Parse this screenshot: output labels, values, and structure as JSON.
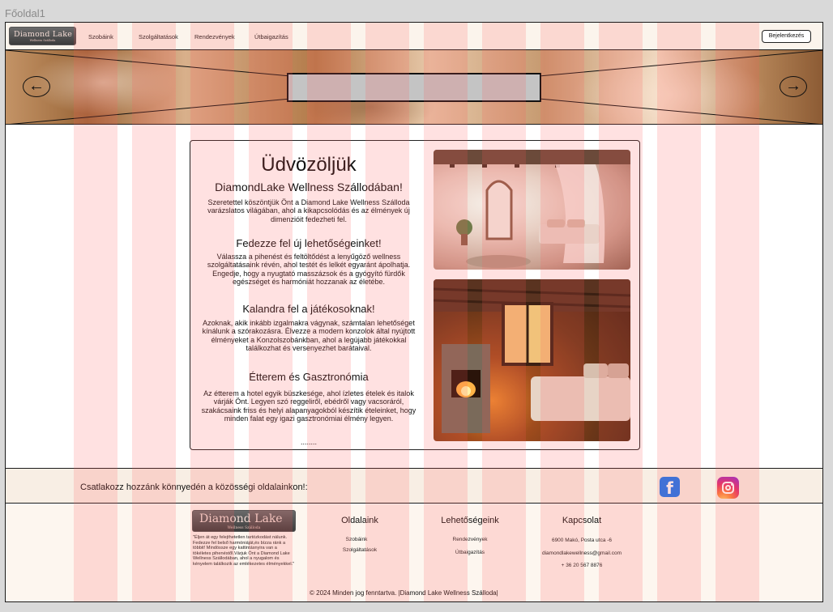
{
  "frame_label": "Főoldal1",
  "nav": {
    "logo_text": "Diamond Lake",
    "logo_sub": "Wellness Szálloda",
    "links": [
      "Szobáink",
      "Szolgáltatások",
      "Rendezvények",
      "Útbaigazítás"
    ],
    "login": "Bejelentkezés"
  },
  "hero": {
    "prev_icon": "arrow-left-icon",
    "next_icon": "arrow-right-icon"
  },
  "content": {
    "title": "Üdvözöljük",
    "subtitle": "DiamondLake Wellness Szállodában!",
    "intro": "Szeretettel köszöntjük Önt a Diamond Lake Wellness Szálloda varázslatos világában, ahol a kikapcsolódás és az élmények új dimenzióit fedezheti fel.",
    "sections": [
      {
        "heading": "Fedezze fel új lehetőségeinket!",
        "text": "Válassza a pihenést és feltöltődést a lenyűgöző wellness szolgáltatásaink révén, ahol testét és lelkét egyaránt ápolhatja. Engedje, hogy a nyugtató masszázsok és a gyógyító fürdők egészséget és harmóniát hozzanak az életébe."
      },
      {
        "heading": "Kalandra fel a játékosoknak!",
        "text": "Azoknak, akik inkább izgalmakra vágynak, számtalan lehetőséget kínálunk a szórakozásra. Élvezze a modern konzolok által nyújtott élményeket a Konzolszobánkban, ahol a legújabb játékokkal találkozhat és versenyezhet barátaival."
      },
      {
        "heading": "Étterem és Gasztronómia",
        "text": "Az étterem a hotel egyik büszkesége, ahol ízletes ételek és italok várják Önt. Legyen szó reggeliről, ebédről vagy vacsoráról, szakácsaink friss és helyi alapanyagokból készítik ételeinket, hogy minden falat egy igazi gasztronómiai élmény legyen."
      }
    ],
    "ellipsis": "........"
  },
  "social": {
    "text": "Csatlakozz hozzánk könnyedén a közösségi oldalainkon!:",
    "icons": [
      "facebook-icon",
      "instagram-icon"
    ],
    "colors": {
      "facebook": "#1877f2",
      "instagram": "#e1306c"
    }
  },
  "footer": {
    "logo_text": "Diamond Lake",
    "logo_sub": "Wellness Szálloda",
    "quote": "\"Éljen át egy felejthetetlen tartózkodást nálunk. Fedezze fel belső harmóniáját,és bízza ránk a többit! Mindössze egy kattintásnyira van a tökéletes pihenéstől.Várjuk Önt a Diamond Lake Wellness Szállodában, ahol a nyugalom és kényelem találkozik az emlékezetes élményekkel.\"",
    "col1": {
      "heading": "Oldalaink",
      "links": [
        "Szobáink",
        "Szolgáltatások"
      ]
    },
    "col2": {
      "heading": "Lehetőségeink",
      "links": [
        "Rendezvények",
        "Útbaigazítás"
      ]
    },
    "col3": {
      "heading": "Kapcsolat",
      "lines": [
        "6900 Makó, Posta utca -6",
        "diamondlakewellness@gmail.com",
        "+ 36 20 567 8876"
      ]
    },
    "copyright": "© 2024 Minden jog fenntartva. |Diamond Lake Wellness Szálloda|"
  },
  "colors": {
    "nav_bg": "#fbf4ec",
    "social_bg": "#f8eee4",
    "footer_bg": "#fdf6ef",
    "grid_overlay": "#ff5a5a"
  }
}
